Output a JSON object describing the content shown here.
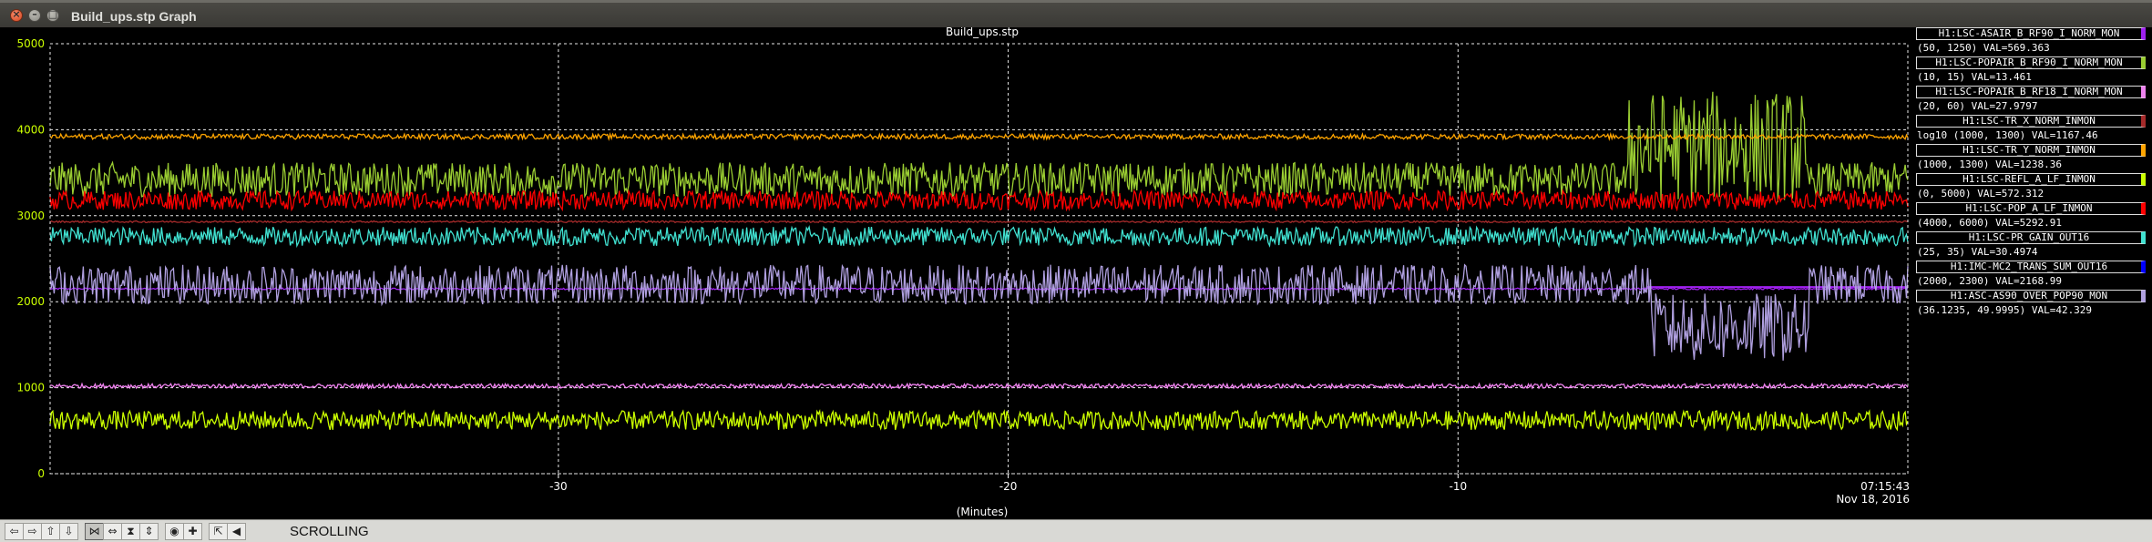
{
  "window": {
    "title": "Build_ups.stp Graph",
    "close_glyph": "×",
    "minimize_glyph": "–",
    "maximize_glyph": "□"
  },
  "toolbar": {
    "buttons": [
      {
        "name": "scroll-left",
        "glyph": "⇦"
      },
      {
        "name": "scroll-right",
        "glyph": "⇨"
      },
      {
        "name": "scroll-up",
        "glyph": "⇧"
      },
      {
        "name": "scroll-down",
        "glyph": "⇩"
      },
      {
        "name": "zoom-x",
        "glyph": "⋈",
        "pressed": true
      },
      {
        "name": "zoom-x-in",
        "glyph": "⇔"
      },
      {
        "name": "zoom-y",
        "glyph": "⧗"
      },
      {
        "name": "zoom-y-in",
        "glyph": "⇕"
      },
      {
        "name": "crosshair",
        "glyph": "◉"
      },
      {
        "name": "add-point",
        "glyph": "✚"
      },
      {
        "name": "autoscale",
        "glyph": "⇱"
      },
      {
        "name": "mode-toggle",
        "glyph": "◀"
      }
    ],
    "mode": "SCROLLING"
  },
  "chart_data": {
    "type": "line",
    "title": "Build_ups.stp",
    "xlabel": "(Minutes)",
    "ylabel": "",
    "xlim": [
      -41.3,
      0
    ],
    "ylim": [
      0,
      5000
    ],
    "grid": true,
    "legend_position": "right",
    "x_ticks": [
      -30,
      -20,
      -10
    ],
    "x_tick_labels": [
      "-30",
      "-20",
      "-10"
    ],
    "y_ticks": [
      0,
      1000,
      2000,
      3000,
      4000,
      5000
    ],
    "y_tick_labels": [
      "0",
      "1000",
      "2000",
      "3000",
      "4000",
      "5000"
    ],
    "time_label": "07:15:43",
    "date_label": "Nov 18, 2016",
    "series": [
      {
        "name": "H1:LSC-ASAIR_B_RF90_I_NORM_MON",
        "range": "(50, 1250) VAL=569.363",
        "color": "#a020f0",
        "display_level": 2150,
        "noise": 10,
        "segments": [
          {
            "x_start": -5.8,
            "x_end": 0,
            "level": 2170
          }
        ]
      },
      {
        "name": "H1:LSC-POPAIR_B_RF90_I_NORM_MON",
        "range": "(10, 15) VAL=13.461",
        "color": "#9acd32",
        "display_level": 3420,
        "noise": 200,
        "spikes": [
          {
            "x_start": -6.2,
            "x_end": -2.3,
            "level": 3800,
            "noise": 650
          }
        ]
      },
      {
        "name": "H1:LSC-POPAIR_B_RF18_I_NORM_MON",
        "range": "(20, 60) VAL=27.9797",
        "color": "#ee82ee",
        "display_level": 1020,
        "noise": 25
      },
      {
        "name": "H1:LSC-TR_X_NORM_INMON",
        "range": "log10 (1000, 1300) VAL=1167.46",
        "color": "#a52a2a",
        "display_level": 2930,
        "noise": 10
      },
      {
        "name": "H1:LSC-TR_Y_NORM_INMON",
        "range": "(1000, 1300) VAL=1238.36",
        "color": "#ffa500",
        "display_level": 3920,
        "noise": 30
      },
      {
        "name": "H1:LSC-REFL_A_LF_INMON",
        "range": "(0, 5000) VAL=572.312",
        "color": "#ccff00",
        "display_level": 620,
        "noise": 110
      },
      {
        "name": "H1:LSC-POP_A_LF_INMON",
        "range": "(4000, 6000) VAL=5292.91",
        "color": "#ff0000",
        "display_level": 3180,
        "noise": 110
      },
      {
        "name": "H1:LSC-PR_GAIN_OUT16",
        "range": "(25, 35) VAL=30.4974",
        "color": "#40e0d0",
        "display_level": 2760,
        "noise": 110
      },
      {
        "name": "H1:IMC-MC2_TRANS_SUM_OUT16",
        "range": "(2000, 2300) VAL=2168.99",
        "color": "#0000ff",
        "display_level": null,
        "noise": 0
      },
      {
        "name": "H1:ASC-AS90_OVER_POP90_MON",
        "range": "(36.1235, 49.9995) VAL=42.329",
        "color": "#b0a0e0",
        "display_level": 2200,
        "noise": 230,
        "dips": [
          {
            "x_start": -5.7,
            "x_end": -2.2,
            "level": 1700,
            "noise": 400
          }
        ]
      }
    ]
  }
}
